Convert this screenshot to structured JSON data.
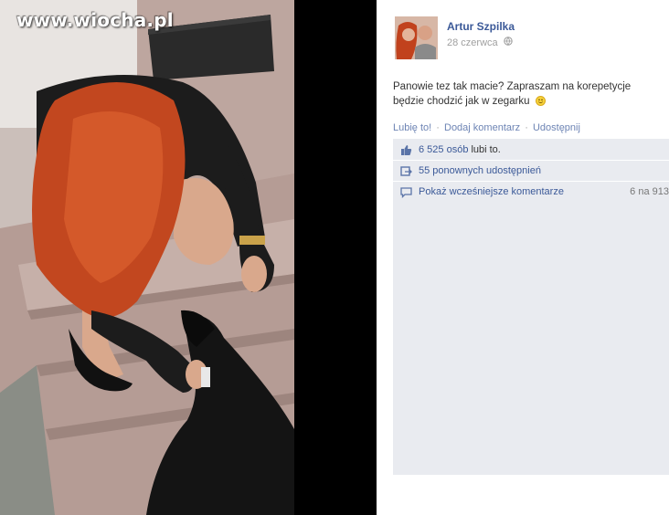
{
  "watermark": "www.wiocha.pl",
  "post": {
    "author": "Artur Szpilka",
    "date": "28 czerwca",
    "privacy_icon": "globe-icon",
    "text_line1": "Panowie tez tak macie? Zapraszam na korepetycje",
    "text_line2": "będzie chodzić jak w zegarku",
    "emoji": "smiley-icon"
  },
  "actions": {
    "like": "Lubię to!",
    "comment": "Dodaj komentarz",
    "share": "Udostępnij",
    "separator": "·"
  },
  "stats": {
    "likes_count": "6 525 osób",
    "likes_suffix": "lubi to.",
    "shares": "55 ponownych udostępnień",
    "earlier_comments": "Pokaż wcześniejsze komentarze",
    "comments_count": "6 na 913"
  },
  "colors": {
    "link": "#3b5998",
    "action_link": "#6d84b4",
    "panel_gray": "#e9ebf0"
  }
}
